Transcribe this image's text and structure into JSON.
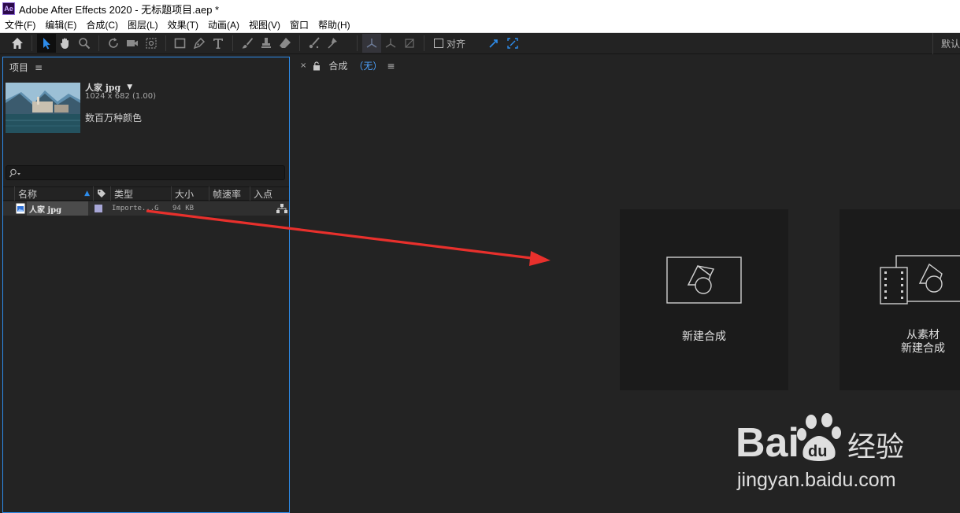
{
  "window": {
    "title": "Adobe After Effects 2020 - 无标题项目.aep *",
    "app_logo": "Ae"
  },
  "menu": [
    "文件(F)",
    "编辑(E)",
    "合成(C)",
    "图层(L)",
    "效果(T)",
    "动画(A)",
    "视图(V)",
    "窗口",
    "帮助(H)"
  ],
  "toolbar": {
    "tools": [
      "home-icon",
      "selection-tool-icon",
      "hand-tool-icon",
      "zoom-tool-icon",
      "rotate-tool-icon",
      "camera-tool-icon",
      "pan-behind-tool-icon",
      "rectangle-tool-icon",
      "pen-tool-icon",
      "text-tool-icon",
      "brush-tool-icon",
      "clone-stamp-tool-icon",
      "eraser-tool-icon",
      "roto-brush-tool-icon",
      "puppet-pin-tool-icon",
      "local-axis-icon",
      "world-axis-icon",
      "view-axis-icon"
    ],
    "snap_label": "对齐",
    "workspace_label": "默认"
  },
  "project_panel": {
    "tab_label": "项目",
    "selected_item": {
      "name": "人家 jpg",
      "dimensions": "1024 x 682 (1.00)",
      "colors": "数百万种颜色"
    },
    "columns": [
      "名称",
      "类型",
      "大小",
      "帧速率",
      "入点"
    ],
    "rows": [
      {
        "name": "人家 jpg",
        "type": "Importe...G",
        "size": "94 KB"
      }
    ]
  },
  "composition_panel": {
    "tab_label": "合成",
    "tab_value": "（无）",
    "cards": [
      {
        "label": "新建合成"
      },
      {
        "label_line1": "从素材",
        "label_line2": "新建合成"
      }
    ]
  },
  "annotation": {
    "arrow_color": "#e8302c"
  },
  "watermark": {
    "brand": "Baidu经验",
    "url": "jingyan.baidu.com"
  },
  "colors": {
    "accent": "#2d8ceb",
    "panel_bg": "#232323",
    "card_bg": "#1b1b1b"
  }
}
